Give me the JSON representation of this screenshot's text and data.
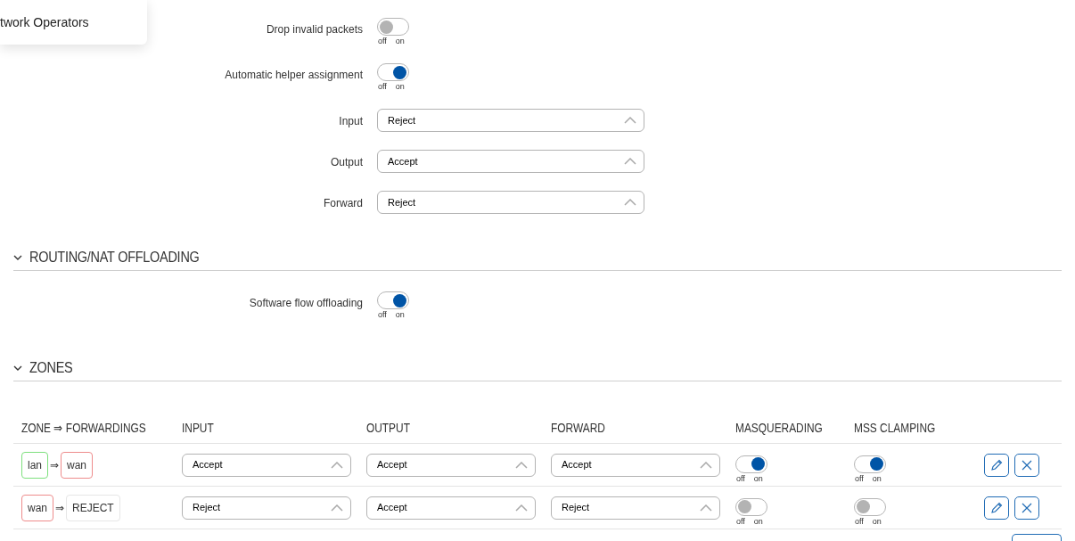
{
  "menu_popup": {
    "label": "twork Operators"
  },
  "general_settings": [
    {
      "kind": "toggle",
      "label": "Drop invalid packets",
      "on": false,
      "off_label": "off",
      "on_label": "on"
    },
    {
      "kind": "toggle",
      "label": "Automatic helper assignment",
      "on": true,
      "off_label": "off",
      "on_label": "on"
    },
    {
      "kind": "select",
      "label": "Input",
      "value": "Reject"
    },
    {
      "kind": "select",
      "label": "Output",
      "value": "Accept"
    },
    {
      "kind": "select",
      "label": "Forward",
      "value": "Reject"
    }
  ],
  "offloading_section": {
    "title": "ROUTING/NAT OFFLOADING",
    "expanded": true,
    "settings": [
      {
        "kind": "toggle",
        "label": "Software flow offloading",
        "on": true,
        "off_label": "off",
        "on_label": "on"
      }
    ]
  },
  "zones_section": {
    "title": "ZONES",
    "expanded": true,
    "columns": [
      "ZONE ⇒ FORWARDINGS",
      "INPUT",
      "OUTPUT",
      "FORWARD",
      "MASQUERADING",
      "MSS CLAMPING"
    ],
    "rows": [
      {
        "zone": {
          "label": "lan",
          "color": "#7ee07e"
        },
        "arrow": "⇒",
        "forwardings": [
          {
            "label": "wan",
            "color": "#ee8c8c"
          }
        ],
        "input": "Accept",
        "output": "Accept",
        "forward": "Accept",
        "masquerading": {
          "on": true,
          "off_label": "off",
          "on_label": "on"
        },
        "mss_clamping": {
          "on": true,
          "off_label": "off",
          "on_label": "on"
        }
      },
      {
        "zone": {
          "label": "wan",
          "color": "#ee8c8c"
        },
        "arrow": "⇒",
        "forwardings": [
          {
            "label": "REJECT",
            "color": "#e6e6e6"
          }
        ],
        "input": "Reject",
        "output": "Accept",
        "forward": "Reject",
        "masquerading": {
          "on": false,
          "off_label": "off",
          "on_label": "on"
        },
        "mss_clamping": {
          "on": false,
          "off_label": "off",
          "on_label": "on"
        }
      }
    ]
  }
}
